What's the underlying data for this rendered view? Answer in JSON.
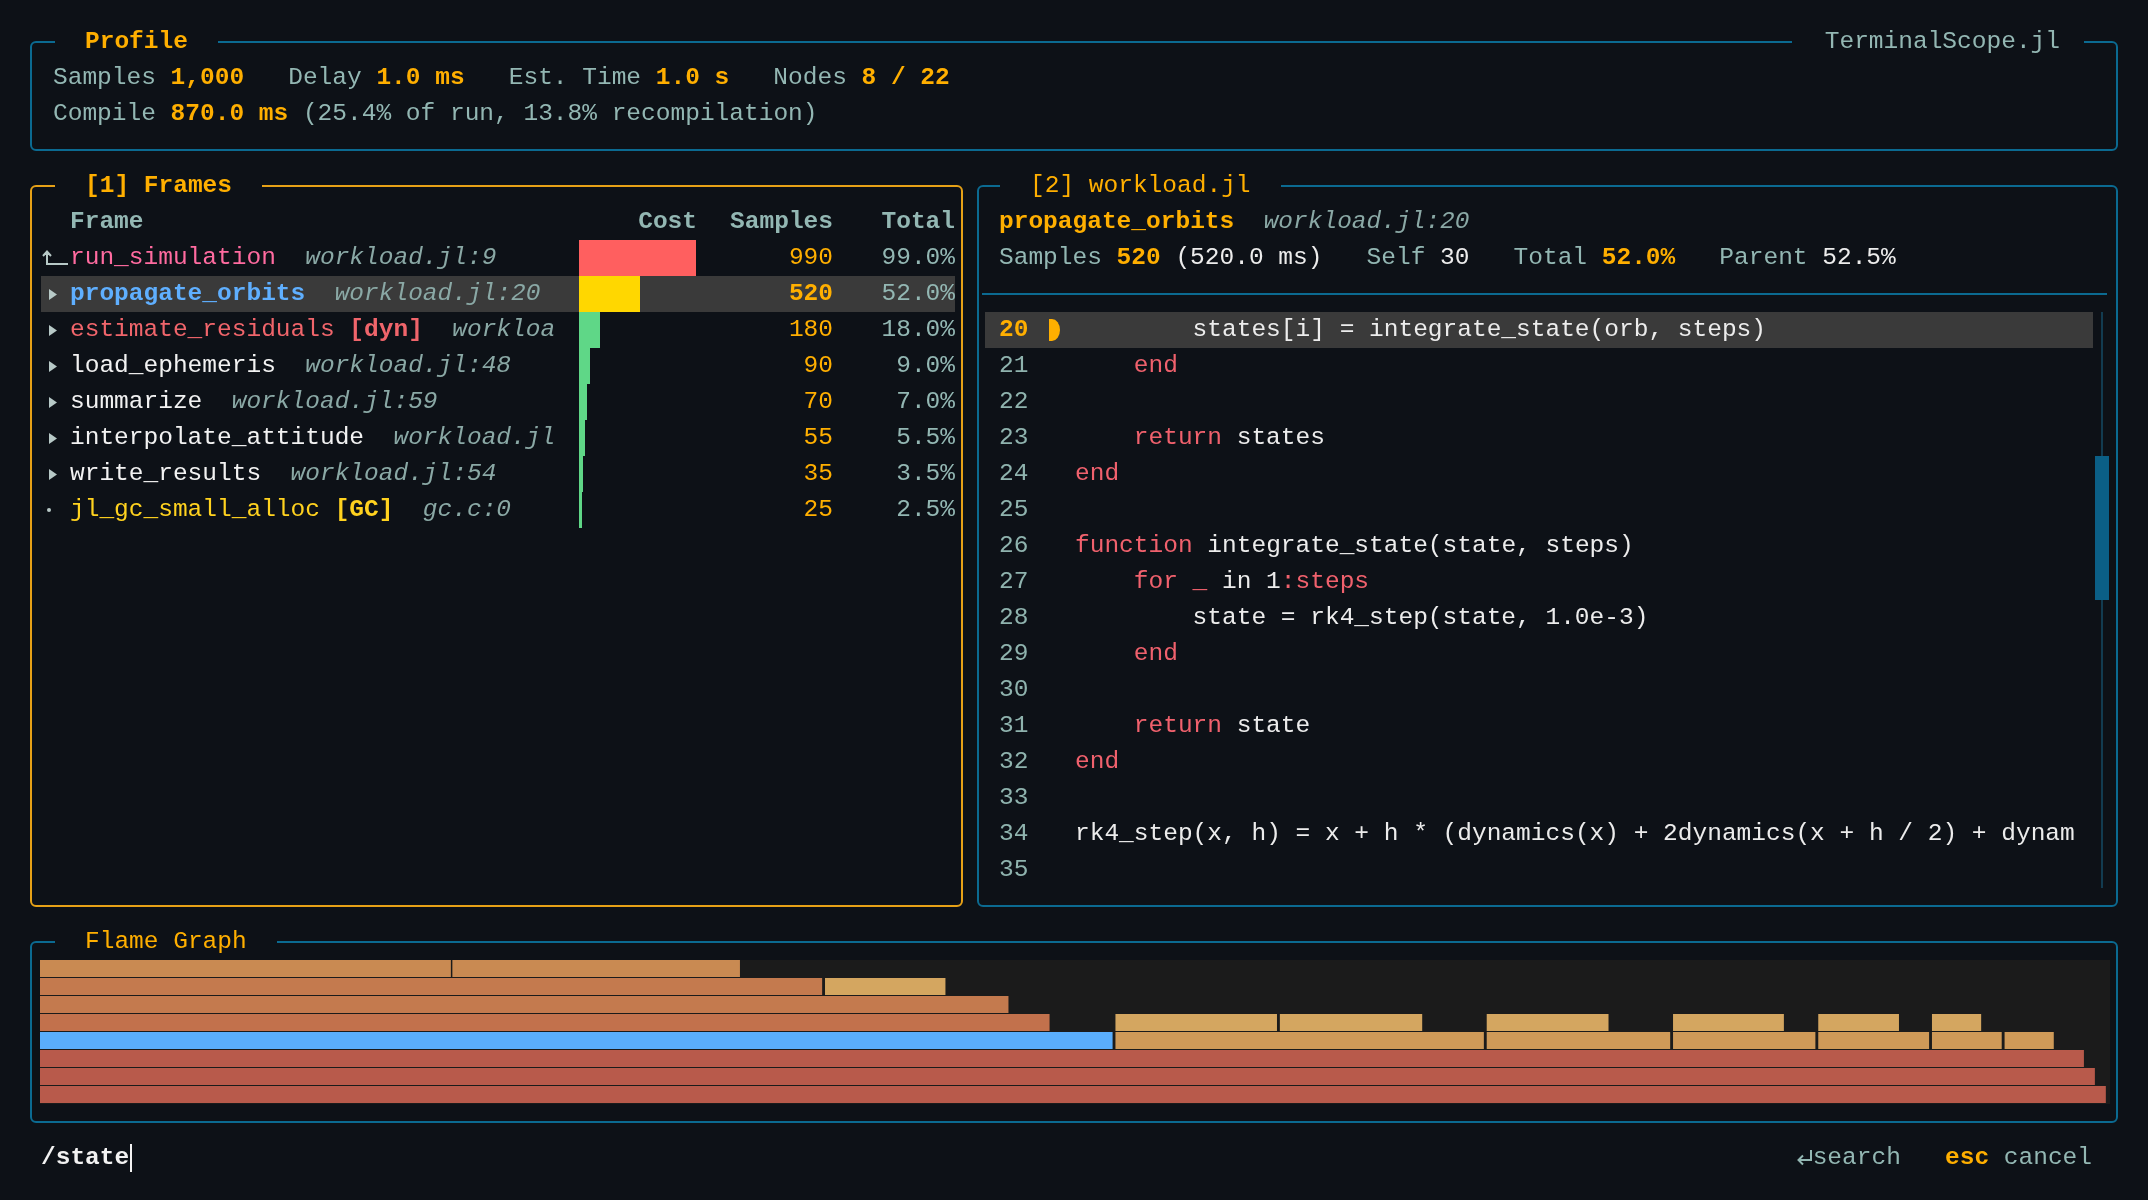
{
  "profile": {
    "title": "Profile",
    "app_name": "TerminalScope.jl",
    "stats": [
      {
        "label": "Samples",
        "value": "1,000"
      },
      {
        "label": "Delay",
        "value": "1.0 ms"
      },
      {
        "label": "Est. Time",
        "value": "1.0 s"
      },
      {
        "label": "Nodes",
        "value": "8 / 22"
      }
    ],
    "compile": {
      "label": "Compile",
      "value": "870.0 ms",
      "note": "(25.4% of run, 13.8% recompilation)"
    }
  },
  "frames": {
    "title": "[1] Frames",
    "focused": true,
    "columns": [
      "Frame",
      "Cost",
      "Samples",
      "Total"
    ],
    "rows": [
      {
        "kind": "parent",
        "name": "run_simulation",
        "location": "workload.jl:9",
        "samples": "990",
        "total": "99.0%",
        "color": "#ff6ba0",
        "selected": false
      },
      {
        "kind": "collapsed",
        "name": "propagate_orbits",
        "location": "workload.jl:20",
        "samples": "520",
        "total": "52.0%",
        "selected": true
      },
      {
        "kind": "collapsed",
        "name": "estimate_residuals",
        "tag": "[dyn]",
        "location": "workloa",
        "samples": "180",
        "total": "18.0%",
        "color": "#f0656b",
        "selected": false
      },
      {
        "kind": "collapsed",
        "name": "load_ephemeris",
        "location": "workload.jl:48",
        "samples": "90",
        "total": "9.0%",
        "color": "#f2f2f2",
        "selected": false
      },
      {
        "kind": "collapsed",
        "name": "summarize",
        "location": "workload.jl:59",
        "samples": "70",
        "total": "7.0%",
        "color": "#f2f2f2",
        "selected": false
      },
      {
        "kind": "collapsed",
        "name": "interpolate_attitude",
        "location": "workload.jl",
        "samples": "55",
        "total": "5.5%",
        "color": "#f2f2f2",
        "selected": false
      },
      {
        "kind": "collapsed",
        "name": "write_results",
        "location": "workload.jl:54",
        "samples": "35",
        "total": "3.5%",
        "color": "#f2f2f2",
        "selected": false
      },
      {
        "kind": "leaf",
        "name": "jl_gc_small_alloc",
        "tag": "[GC]",
        "location": "gc.c:0",
        "samples": "25",
        "total": "2.5%",
        "color": "#ffd21f",
        "selected": false
      }
    ]
  },
  "code": {
    "title": "[2] workload.jl",
    "focused": false,
    "function": "propagate_orbits",
    "location": "workload.jl:20",
    "stats": [
      {
        "label": "Samples",
        "value": "520",
        "note": "(520.0 ms)",
        "emphasis": true
      },
      {
        "label": "Self",
        "value": "30",
        "emphasis": false
      },
      {
        "label": "Total",
        "value": "52.0%",
        "emphasis": true
      },
      {
        "label": "Parent",
        "value": "52.5%",
        "emphasis": false
      }
    ],
    "lines": [
      {
        "number": "20",
        "current": true,
        "tokens": [
          {
            "kind": "text",
            "text": "        states[i] = integrate_state(orb, steps)"
          }
        ]
      },
      {
        "number": "21",
        "current": false,
        "tokens": [
          {
            "kind": "keyword",
            "text": "    end"
          }
        ]
      },
      {
        "number": "22",
        "current": false
      },
      {
        "number": "23",
        "current": false,
        "tokens": [
          {
            "kind": "keyword",
            "text": "    return"
          },
          {
            "kind": "text",
            "text": " states"
          }
        ]
      },
      {
        "number": "24",
        "current": false,
        "tokens": [
          {
            "kind": "keyword",
            "text": "end"
          }
        ]
      },
      {
        "number": "25",
        "current": false
      },
      {
        "number": "26",
        "current": false,
        "tokens": [
          {
            "kind": "keyword",
            "text": "function"
          },
          {
            "kind": "text",
            "text": " integrate_state(state, steps)"
          }
        ]
      },
      {
        "number": "27",
        "current": false,
        "tokens": [
          {
            "kind": "keyword",
            "text": "    for _"
          },
          {
            "kind": "text",
            "text": " in 1"
          },
          {
            "kind": "keyword",
            "text": ":steps"
          }
        ]
      },
      {
        "number": "28",
        "current": false,
        "tokens": [
          {
            "kind": "text",
            "text": "        state = rk4_step(state, 1.0e-3)"
          }
        ]
      },
      {
        "number": "29",
        "current": false,
        "tokens": [
          {
            "kind": "keyword",
            "text": "    end"
          }
        ]
      },
      {
        "number": "30",
        "current": false
      },
      {
        "number": "31",
        "current": false,
        "tokens": [
          {
            "kind": "keyword",
            "text": "    return"
          },
          {
            "kind": "text",
            "text": " state"
          }
        ]
      },
      {
        "number": "32",
        "current": false,
        "tokens": [
          {
            "kind": "keyword",
            "text": "end"
          }
        ]
      },
      {
        "number": "33",
        "current": false
      },
      {
        "number": "34",
        "current": false,
        "tokens": [
          {
            "kind": "text",
            "text": "rk4_step(x, h) = x + h * (dynamics(x) + 2dynamics(x + h / 2) + dynam"
          }
        ]
      },
      {
        "number": "35",
        "current": false
      }
    ]
  },
  "flame": {
    "title": "Flame Graph"
  },
  "search": {
    "value": "/state",
    "hints": [
      {
        "kind": "enter",
        "action": "search"
      },
      {
        "kind": "key",
        "key": "esc",
        "action": "cancel"
      }
    ]
  }
}
